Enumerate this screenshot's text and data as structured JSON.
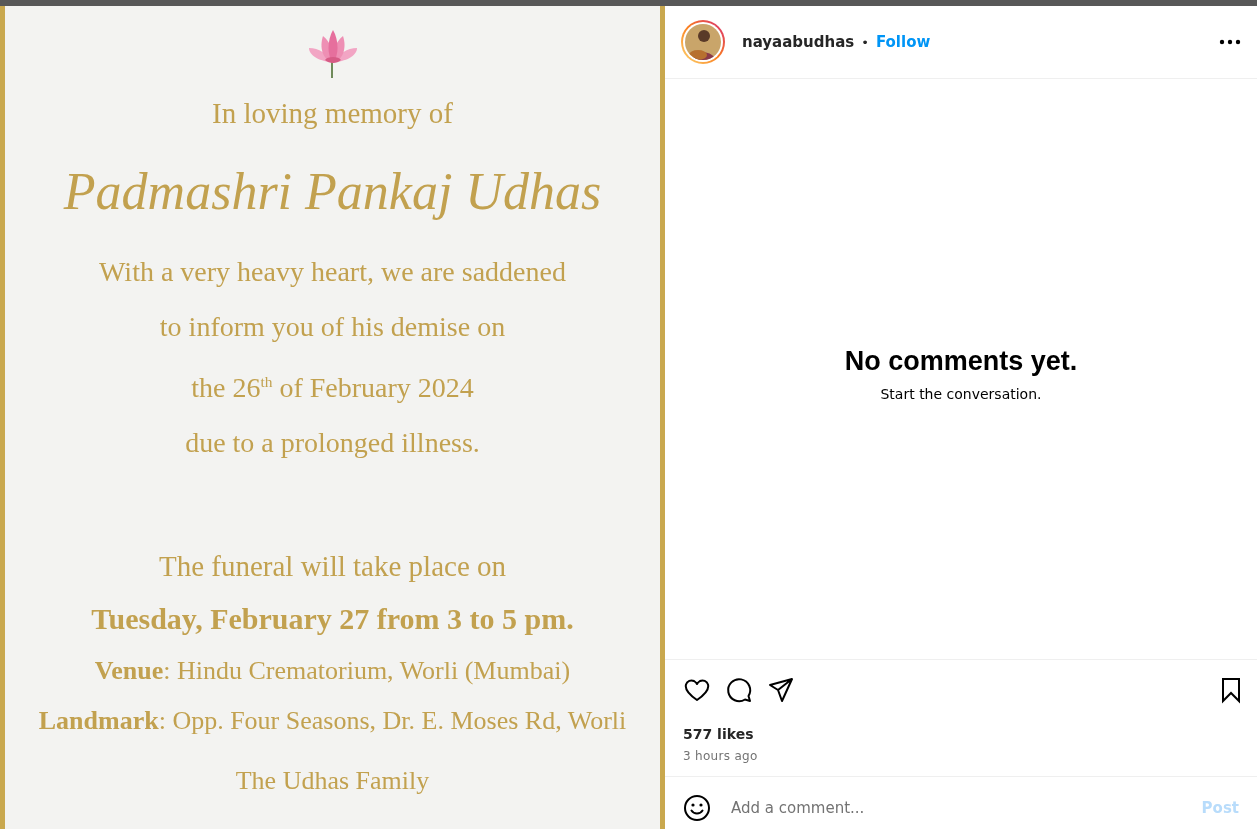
{
  "card": {
    "lines": [
      {
        "kind": "intro",
        "text": "In loving memory of"
      },
      {
        "kind": "name",
        "text": "Padmashri Pankaj Udhas"
      },
      {
        "kind": "body",
        "text": "With a very heavy heart, we are saddened"
      },
      {
        "kind": "body",
        "text": "to inform you of his demise on"
      },
      {
        "kind": "body",
        "text": "the 26$^{th}$ of February 2024"
      },
      {
        "kind": "body",
        "text": "due to a prolonged illness."
      },
      {
        "kind": "lead",
        "text": "The funeral will take place on"
      },
      {
        "kind": "emphasis",
        "text": "Tuesday, February 27 from 3 to 5 pm."
      },
      {
        "kind": "detail",
        "text": "**Venue**: Hindu Crematorium, Worli (Mumbai)"
      },
      {
        "kind": "detail",
        "text": "**Landmark**: Opp. Four Seasons, Dr. E. Moses Rd, Worli"
      },
      {
        "kind": "signature",
        "text": "The Udhas Family"
      }
    ]
  },
  "header": {
    "username": "nayaabudhas",
    "separator": "•",
    "follow": "Follow"
  },
  "comments": {
    "empty_title": "No comments yet.",
    "empty_hint": "Start the conversation."
  },
  "actions": {
    "liked": false,
    "saved": false
  },
  "likes": "577 likes",
  "time": "3 hours ago",
  "comment_box": {
    "placeholder": "Add a comment...",
    "post": "Post",
    "post_enabled": false
  }
}
